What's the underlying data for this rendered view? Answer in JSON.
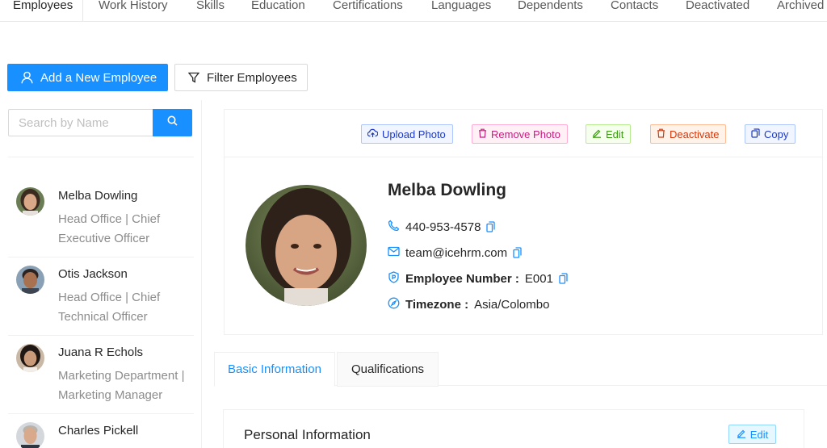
{
  "top_tabs": [
    {
      "label": "Employees"
    },
    {
      "label": "Work History"
    },
    {
      "label": "Skills"
    },
    {
      "label": "Education"
    },
    {
      "label": "Certifications"
    },
    {
      "label": "Languages"
    },
    {
      "label": "Dependents"
    },
    {
      "label": "Contacts"
    },
    {
      "label": "Deactivated"
    },
    {
      "label": "Archived"
    }
  ],
  "toolbar": {
    "add_label": "Add a New Employee",
    "filter_label": "Filter Employees"
  },
  "search": {
    "placeholder": "Search by Name"
  },
  "employees": [
    {
      "name": "Melba Dowling",
      "desc": "Head Office | Chief Executive Officer"
    },
    {
      "name": "Otis Jackson",
      "desc": "Head Office | Chief Technical Officer"
    },
    {
      "name": "Juana R Echols",
      "desc": "Marketing Department | Marketing Manager"
    },
    {
      "name": "Charles Pickell",
      "desc": ""
    }
  ],
  "profile_actions": {
    "upload": "Upload Photo",
    "remove": "Remove Photo",
    "edit": "Edit",
    "deactivate": "Deactivate",
    "copy": "Copy"
  },
  "profile": {
    "name": "Melba Dowling",
    "phone": "440-953-4578",
    "email": "team@icehrm.com",
    "employee_number_label": "Employee Number :",
    "employee_number": "E001",
    "timezone_label": "Timezone :",
    "timezone": "Asia/Colombo"
  },
  "info_tabs": [
    {
      "label": "Basic Information"
    },
    {
      "label": "Qualifications"
    }
  ],
  "personal_info": {
    "title": "Personal Information",
    "edit_label": "Edit"
  },
  "colors": {
    "primary": "#1890ff",
    "text": "#262626",
    "muted": "#8c8c8c"
  }
}
